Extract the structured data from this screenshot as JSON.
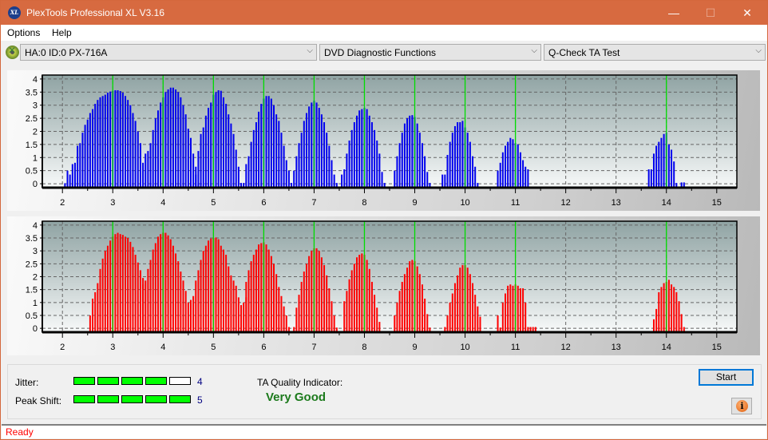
{
  "window": {
    "title": "PlexTools Professional XL V3.16",
    "app_icon_text": "XL",
    "minimize_glyph": "—",
    "maximize_glyph": "☐",
    "close_glyph": "✕"
  },
  "menu": {
    "items": [
      {
        "label": "Options"
      },
      {
        "label": "Help"
      }
    ]
  },
  "toolbar": {
    "drive_select": "HA:0 ID:0  PX-716A",
    "function_select": "DVD Diagnostic Functions",
    "test_select": "Q-Check TA Test",
    "chevron_glyph": "⌵"
  },
  "colors": {
    "top_bars": "#0000ee",
    "bottom_bars": "#ff0000",
    "marker_lines": "#00dd00",
    "meter_on": "#00ff00",
    "quality_text": "#1c7a1c",
    "status_text": "#ff0000"
  },
  "chart_data": [
    {
      "type": "bar",
      "name": "top-chart",
      "series_color": "#0000ee",
      "xlim": [
        1.6,
        15.4
      ],
      "ylim": [
        -0.15,
        4.15
      ],
      "x_ticks": [
        2,
        3,
        4,
        5,
        6,
        7,
        8,
        9,
        10,
        11,
        12,
        13,
        14,
        15
      ],
      "y_ticks": [
        0,
        0.5,
        1,
        1.5,
        2,
        2.5,
        3,
        3.5,
        4
      ],
      "y_tick_labels": [
        "0",
        "0.5",
        "1",
        "1.5",
        "2",
        "2.5",
        "3",
        "3.5",
        "4"
      ],
      "grid": true,
      "markers": [
        3,
        4,
        5,
        6,
        7,
        8,
        9,
        10,
        11,
        14
      ],
      "peaks": [
        {
          "center": 3.0,
          "start": 1.95,
          "end": 3.55,
          "peak": 3.57,
          "values": [
            0.0,
            0,
            0.02,
            0.5,
            0.35,
            0.75,
            0.8,
            1.45,
            1.55,
            1.95,
            2.25,
            2.45,
            2.7,
            2.85,
            3.05,
            3.2,
            3.3,
            3.35,
            3.4,
            3.48,
            3.52,
            3.55,
            3.57,
            3.57,
            3.54,
            3.48,
            3.35,
            3.2,
            3.0,
            2.7,
            2.4,
            2.0,
            1.55
          ]
        },
        {
          "center": 4.0,
          "start": 3.6,
          "end": 4.55,
          "peak": 3.67,
          "values": [
            0.8,
            1.15,
            1.25,
            1.55,
            2.05,
            2.5,
            2.8,
            3.1,
            3.3,
            3.5,
            3.6,
            3.67,
            3.67,
            3.6,
            3.5,
            3.3,
            3.0,
            2.65,
            2.1,
            1.75,
            1.15,
            0.35,
            0.03
          ]
        },
        {
          "center": 5.0,
          "start": 4.65,
          "end": 5.45,
          "peak": 3.57,
          "values": [
            0.65,
            1.25,
            1.9,
            2.15,
            2.6,
            2.9,
            3.1,
            3.4,
            3.5,
            3.57,
            3.55,
            3.3,
            3.05,
            2.65,
            2.3,
            1.9,
            1.3,
            0.65,
            0.03
          ]
        },
        {
          "center": 6.0,
          "start": 5.6,
          "end": 6.5,
          "peak": 3.35,
          "values": [
            0.03,
            0.75,
            1.05,
            1.6,
            2.05,
            2.35,
            2.75,
            3.05,
            3.25,
            3.35,
            3.35,
            3.25,
            3.0,
            2.65,
            2.4,
            1.95,
            1.45,
            0.9,
            0.5,
            0.03
          ]
        },
        {
          "center": 7.0,
          "start": 6.6,
          "end": 7.5,
          "peak": 3.17,
          "values": [
            0.5,
            1.05,
            1.55,
            1.95,
            2.4,
            2.7,
            2.95,
            3.1,
            3.17,
            3.1,
            2.9,
            2.65,
            2.35,
            1.95,
            1.45,
            0.9,
            0.35,
            0.03
          ]
        },
        {
          "center": 8.0,
          "start": 7.55,
          "end": 8.45,
          "peak": 2.9,
          "values": [
            0.35,
            0.55,
            1.15,
            1.65,
            2.05,
            2.35,
            2.6,
            2.8,
            2.85,
            2.9,
            2.85,
            2.6,
            2.35,
            2.05,
            1.65,
            1.15,
            0.45,
            0.03
          ]
        },
        {
          "center": 9.0,
          "start": 8.6,
          "end": 9.4,
          "peak": 2.62,
          "values": [
            0.5,
            1.05,
            1.55,
            1.95,
            2.3,
            2.5,
            2.6,
            2.62,
            2.55,
            2.3,
            1.95,
            1.55,
            1.05,
            0.45,
            0.03
          ]
        },
        {
          "center": 10.0,
          "start": 9.55,
          "end": 10.35,
          "peak": 2.4,
          "values": [
            0.35,
            0.35,
            1.1,
            1.6,
            1.95,
            2.2,
            2.35,
            2.35,
            2.4,
            2.15,
            1.95,
            1.6,
            1.05,
            0.65,
            0.03
          ]
        },
        {
          "center": 11.0,
          "start": 10.65,
          "end": 11.35,
          "peak": 1.75,
          "values": [
            0.5,
            0.8,
            1.2,
            1.45,
            1.6,
            1.75,
            1.7,
            1.55,
            1.5,
            1.2,
            0.9,
            0.65,
            0.55
          ]
        },
        {
          "center": 14.0,
          "start": 13.65,
          "end": 14.4,
          "peak": 1.95,
          "values": [
            0.55,
            0.55,
            1.15,
            1.45,
            1.6,
            1.75,
            1.9,
            1.95,
            1.5,
            1.3,
            0.85,
            0.03,
            0,
            0.05,
            0.05
          ]
        }
      ]
    },
    {
      "type": "bar",
      "name": "bottom-chart",
      "series_color": "#ff0000",
      "xlim": [
        1.6,
        15.4
      ],
      "ylim": [
        -0.15,
        4.15
      ],
      "x_ticks": [
        2,
        3,
        4,
        5,
        6,
        7,
        8,
        9,
        10,
        11,
        12,
        13,
        14,
        15
      ],
      "y_ticks": [
        0,
        0.5,
        1,
        1.5,
        2,
        2.5,
        3,
        3.5,
        4
      ],
      "y_tick_labels": [
        "0",
        "0.5",
        "1",
        "1.5",
        "2",
        "2.5",
        "3",
        "3.5",
        "4"
      ],
      "grid": true,
      "markers": [
        3,
        4,
        5,
        6,
        7,
        8,
        9,
        10,
        11,
        14
      ],
      "peaks": [
        {
          "center": 3.0,
          "start": 2.55,
          "end": 3.55,
          "peak": 3.7,
          "values": [
            0.5,
            1.15,
            1.4,
            1.75,
            2.3,
            2.7,
            3.0,
            3.2,
            3.4,
            3.55,
            3.65,
            3.7,
            3.65,
            3.62,
            3.55,
            3.5,
            3.35,
            3.15,
            2.85,
            2.55,
            2.25,
            1.95
          ]
        },
        {
          "center": 4.0,
          "start": 3.6,
          "end": 4.55,
          "peak": 3.7,
          "values": [
            1.7,
            1.85,
            2.3,
            2.65,
            3.05,
            3.3,
            3.55,
            3.65,
            3.7,
            3.7,
            3.6,
            3.45,
            3.2,
            2.9,
            2.6,
            2.2,
            1.85,
            1.45,
            1.0,
            1.1
          ]
        },
        {
          "center": 5.0,
          "start": 4.6,
          "end": 5.5,
          "peak": 3.52,
          "values": [
            1.25,
            1.85,
            2.25,
            2.65,
            3.0,
            3.2,
            3.4,
            3.48,
            3.5,
            3.52,
            3.45,
            3.2,
            3.05,
            2.85,
            2.4,
            2.05,
            1.85,
            1.65,
            1.2,
            0.9,
            1.0,
            1.2
          ]
        },
        {
          "center": 6.0,
          "start": 5.65,
          "end": 6.5,
          "peak": 3.33,
          "values": [
            1.8,
            2.25,
            2.6,
            2.85,
            3.05,
            3.25,
            3.3,
            3.33,
            3.25,
            3.05,
            2.8,
            2.5,
            2.1,
            1.6,
            1.25,
            0.85,
            0.5,
            0.05
          ]
        },
        {
          "center": 7.0,
          "start": 6.6,
          "end": 7.5,
          "peak": 3.1,
          "values": [
            0.05,
            0.8,
            1.3,
            1.8,
            2.2,
            2.5,
            2.8,
            3.0,
            3.1,
            3.1,
            3.0,
            2.75,
            2.45,
            2.05,
            1.55,
            1.05,
            0.5,
            0.03
          ]
        },
        {
          "center": 8.0,
          "start": 7.6,
          "end": 8.45,
          "peak": 2.9,
          "values": [
            1.05,
            1.45,
            1.9,
            2.25,
            2.5,
            2.75,
            2.85,
            2.9,
            2.85,
            2.65,
            2.3,
            1.8,
            1.3,
            0.8,
            0.25
          ]
        },
        {
          "center": 9.0,
          "start": 8.6,
          "end": 9.45,
          "peak": 2.65,
          "values": [
            0.5,
            1.0,
            1.45,
            1.8,
            2.1,
            2.35,
            2.6,
            2.65,
            2.6,
            2.4,
            2.1,
            1.7,
            1.15,
            0.55,
            0.03
          ]
        },
        {
          "center": 10.0,
          "start": 9.6,
          "end": 10.45,
          "peak": 2.45,
          "values": [
            0.05,
            0.5,
            1.0,
            1.35,
            1.75,
            2.05,
            2.35,
            2.45,
            2.45,
            2.35,
            2.1,
            1.75,
            1.3,
            0.85,
            0.45
          ]
        },
        {
          "center": 11.0,
          "start": 10.65,
          "end": 11.5,
          "peak": 1.7,
          "values": [
            0.5,
            0.03,
            1.0,
            1.35,
            1.65,
            1.7,
            1.65,
            1.7,
            1.65,
            1.55,
            1.55,
            1.0,
            0.05,
            0.05,
            0.05,
            0.05
          ]
        },
        {
          "center": 14.0,
          "start": 13.75,
          "end": 14.4,
          "peak": 1.88,
          "values": [
            0.35,
            0.75,
            1.4,
            1.6,
            1.75,
            1.8,
            1.88,
            1.7,
            1.6,
            1.4,
            1.05,
            0.55,
            0.05
          ]
        }
      ]
    }
  ],
  "bottom_panel": {
    "jitter_label": "Jitter:",
    "jitter_value": "4",
    "jitter_level": 4,
    "peak_shift_label": "Peak Shift:",
    "peak_shift_value": "5",
    "peak_shift_level": 5,
    "meter_segments": 5,
    "ta_quality_label": "TA Quality Indicator:",
    "ta_quality_value": "Very Good",
    "start_label": "Start",
    "info_glyph": "i"
  },
  "status": {
    "text": "Ready"
  }
}
